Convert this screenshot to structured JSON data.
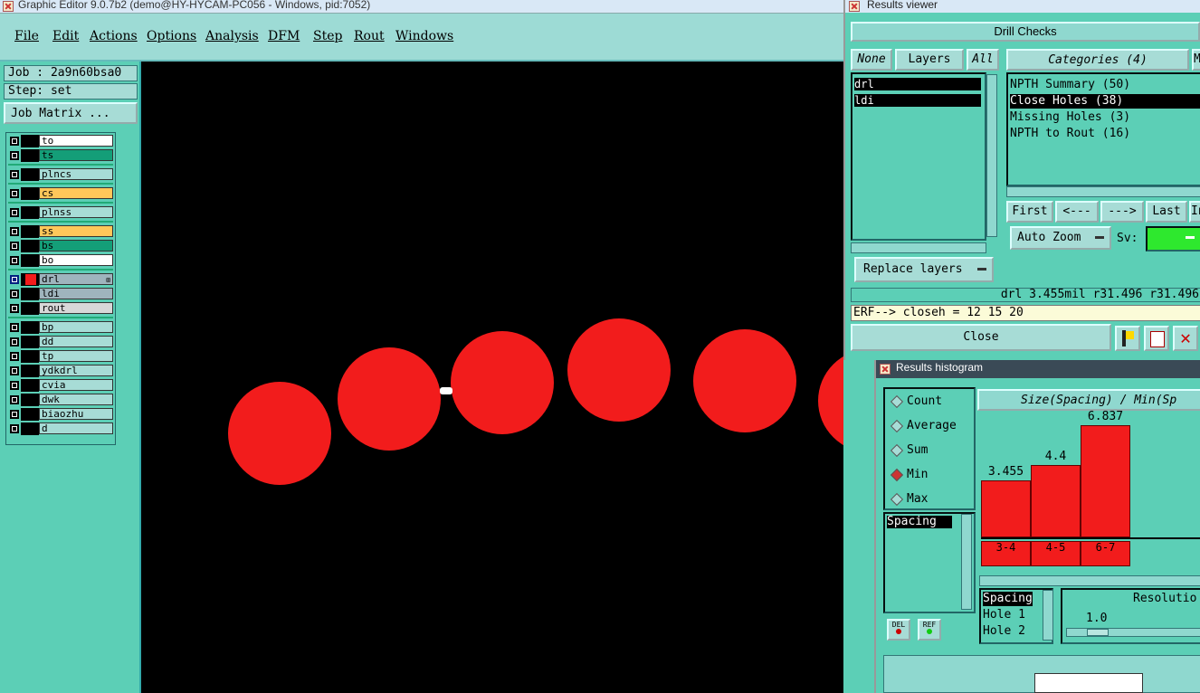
{
  "main_window": {
    "title": "Graphic Editor 9.0.7b2 (demo@HY-HYCAM-PC056 - Windows, pid:7052)",
    "menu": [
      "File",
      "Edit",
      "Actions",
      "Options",
      "Analysis",
      "DFM",
      "Step",
      "Rout",
      "Windows"
    ],
    "job": "Job : 2a9n60bsa0",
    "step": "Step: set",
    "job_matrix_button": "Job Matrix ...",
    "layers": [
      {
        "name": "to",
        "color": "#ffffff"
      },
      {
        "name": "ts",
        "color": "#149e78"
      },
      {
        "name": "plncs",
        "color": "#a7dcd6"
      },
      {
        "name": "cs",
        "color": "#ffc75a"
      },
      {
        "name": "plnss",
        "color": "#a7dcd6"
      },
      {
        "name": "ss",
        "color": "#ffc75a"
      },
      {
        "name": "bs",
        "color": "#149e78"
      },
      {
        "name": "bo",
        "color": "#ffffff"
      },
      {
        "name": "drl",
        "color": "#9fb4bd"
      },
      {
        "name": "ldi",
        "color": "#9fb4bd"
      },
      {
        "name": "rout",
        "color": "#d8d8d8"
      },
      {
        "name": "bp",
        "color": "#a7dcd6"
      },
      {
        "name": "dd",
        "color": "#a7dcd6"
      },
      {
        "name": "tp",
        "color": "#a7dcd6"
      },
      {
        "name": "ydkdrl",
        "color": "#a7dcd6"
      },
      {
        "name": "cvia",
        "color": "#a7dcd6"
      },
      {
        "name": "dwk",
        "color": "#a7dcd6"
      },
      {
        "name": "biaozhu",
        "color": "#a7dcd6"
      },
      {
        "name": "d",
        "color": "#a7dcd6"
      }
    ]
  },
  "results_viewer": {
    "title": "Results viewer",
    "header": "Drill Checks",
    "layer_buttons": [
      "None",
      "Layers",
      "All"
    ],
    "layer_list": [
      "drl",
      "ldi"
    ],
    "categories_label": "Categories (4)",
    "categories_cut": "M",
    "categories": [
      "NPTH Summary (50)",
      "Close Holes (38)",
      "Missing Holes (3)",
      "NPTH to Rout (16)"
    ],
    "selected_category": 1,
    "nav": [
      "First",
      "<---",
      "--->",
      "Last",
      "In"
    ],
    "auto_zoom": "Auto Zoom",
    "sv_label": "Sv:",
    "replace_layers": "Replace layers",
    "status": "drl 3.455mil  r31.496  r31.496",
    "erf": "ERF--> closeh = 12 15 20",
    "close": "Close"
  },
  "histogram": {
    "title": "Results histogram",
    "modes": [
      "Count",
      "Average",
      "Sum",
      "Min",
      "Max"
    ],
    "selected_mode": "Min",
    "list_item": "Spacing",
    "chart_title": "Size(Spacing) / Min(Sp",
    "del_label": "DEL",
    "ref_label": "REF",
    "bottom_list": [
      "Spacing",
      "Hole 1",
      "Hole 2"
    ],
    "resolution_label": "Resolutio",
    "resolution_value": "1.0",
    "colors": {
      "bar": "#f21c1c"
    }
  },
  "chart_data": {
    "type": "bar",
    "categories": [
      "3-4",
      "4-5",
      "6-7"
    ],
    "values": [
      3.455,
      4.4,
      6.837
    ],
    "value_labels": [
      "3.455",
      "4.4",
      "6.837"
    ],
    "title": "Size(Spacing) / Min(Sp"
  }
}
